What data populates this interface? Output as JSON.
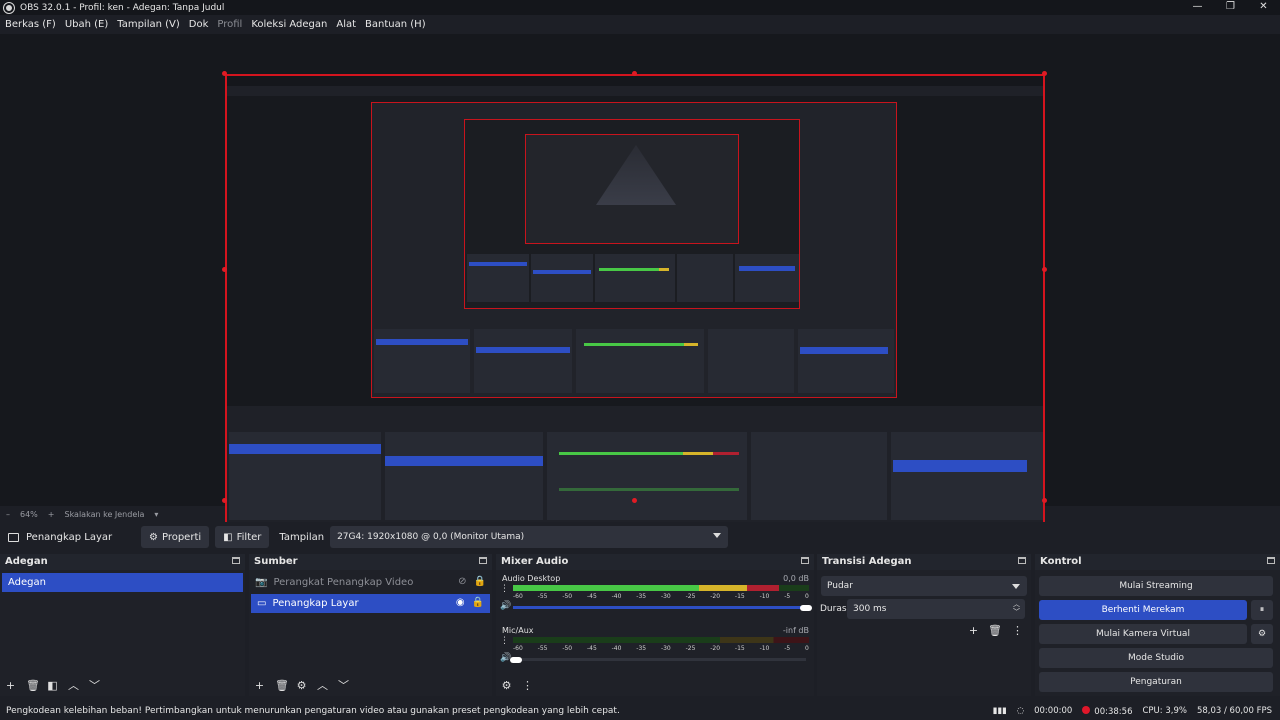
{
  "window": {
    "title": "OBS 32.0.1 - Profil: ken - Adegan: Tanpa Judul",
    "controls": [
      "—",
      "❐",
      "✕"
    ]
  },
  "menu": [
    "Berkas (F)",
    "Ubah (E)",
    "Tampilan (V)",
    "Dok",
    "Profil",
    "Koleksi Adegan",
    "Alat",
    "Bantuan (H)"
  ],
  "zoom": {
    "minus": "–",
    "level": "64%",
    "plus": "+",
    "mode": "Skalakan ke Jendela"
  },
  "source_toolbar": {
    "selected_source": "Penangkap Layar",
    "properties": "Properti",
    "filter": "Filter",
    "display_label": "Tampilan",
    "display_value": "27G4: 1920x1080 @ 0,0 (Monitor Utama)"
  },
  "scenes": {
    "title": "Adegan",
    "items": [
      "Adegan"
    ]
  },
  "sources": {
    "title": "Sumber",
    "items": [
      {
        "label": "Perangkat Penangkap Video",
        "icon": "camera-icon",
        "visible": false,
        "dim": true
      },
      {
        "label": "Penangkap Layar",
        "icon": "monitor-icon",
        "visible": true,
        "selected": true
      }
    ]
  },
  "mixer": {
    "title": "Mixer Audio",
    "channels": [
      {
        "name": "Audio Desktop",
        "db": "0,0 dB",
        "level_fraction": 0.9
      },
      {
        "name": "Mic/Aux",
        "db": "-inf dB",
        "level_fraction": 0.0
      }
    ],
    "ticks": [
      "-60",
      "-55",
      "-50",
      "-45",
      "-40",
      "-35",
      "-30",
      "-25",
      "-20",
      "-15",
      "-10",
      "-5",
      "0"
    ]
  },
  "transitions": {
    "title": "Transisi Adegan",
    "selected": "Pudar",
    "duration_label": "Durasi",
    "duration_value": "300 ms"
  },
  "controls": {
    "title": "Kontrol",
    "buttons": [
      "Mulai Streaming",
      "Berhenti Merekam",
      "Mulai Kamera Virtual",
      "Mode Studio",
      "Pengaturan"
    ]
  },
  "status": {
    "message": "Pengkodean kelebihan beban! Pertimbangkan untuk menurunkan pengaturan video atau gunakan preset pengkodean yang lebih cepat.",
    "stream_time": "00:00:00",
    "rec_time": "00:38:56",
    "cpu": "CPU: 3,9%",
    "fps": "58,03 / 60,00 FPS"
  },
  "colors": {
    "accent": "#2d4ec4",
    "record": "#e0172a",
    "selection_border": "#d4141e"
  }
}
